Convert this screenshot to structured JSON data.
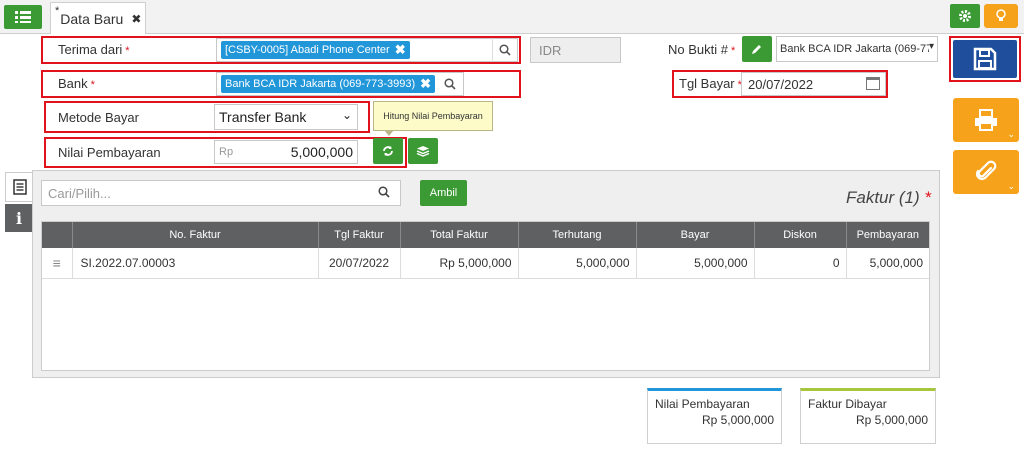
{
  "tab": {
    "title": "Data Baru",
    "modified_marker": "*",
    "close": "✖"
  },
  "form": {
    "terima_dari": {
      "label": "Terima dari",
      "required": "*",
      "value": "[CSBY-0005] Abadi Phone Center"
    },
    "currency": "IDR",
    "no_bukti": {
      "label": "No Bukti #",
      "required": "*",
      "value": "Bank BCA IDR Jakarta (069-77"
    },
    "bank": {
      "label": "Bank",
      "required": "*",
      "value": "Bank BCA IDR Jakarta (069-773-3993)"
    },
    "tgl_bayar": {
      "label": "Tgl Bayar",
      "required": "*",
      "value": "20/07/2022"
    },
    "metode_bayar": {
      "label": "Metode Bayar",
      "value": "Transfer Bank"
    },
    "tooltip": "Hitung Nilai Pembayaran",
    "nilai_pembayaran": {
      "label": "Nilai Pembayaran",
      "prefix": "Rp",
      "value": "5,000,000"
    }
  },
  "search": {
    "placeholder": "Cari/Pilih...",
    "ambil_label": "Ambil"
  },
  "faktur_title": "Faktur (1)",
  "faktur_required": "*",
  "table": {
    "columns": [
      "No. Faktur",
      "Tgl Faktur",
      "Total Faktur",
      "Terhutang",
      "Bayar",
      "Diskon",
      "Pembayaran"
    ],
    "rows": [
      {
        "no": "SI.2022.07.00003",
        "tgl": "20/07/2022",
        "total": "Rp 5,000,000",
        "terhutang": "5,000,000",
        "bayar": "5,000,000",
        "diskon": "0",
        "pembayaran": "5,000,000"
      }
    ]
  },
  "summary": {
    "nilai": {
      "label": "Nilai Pembayaran",
      "value": "Rp 5,000,000"
    },
    "faktur": {
      "label": "Faktur Dibayar",
      "value": "Rp 5,000,000"
    }
  },
  "colors": {
    "green": "#3c9a35",
    "orange": "#f7a21b",
    "blue_save": "#1f4f9c",
    "tag_blue": "#2196d9",
    "red": "#e0121b"
  }
}
